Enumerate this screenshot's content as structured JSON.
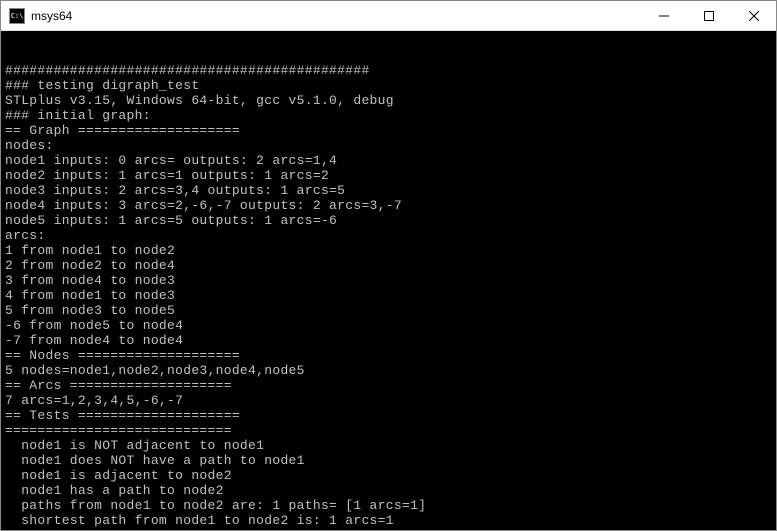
{
  "window": {
    "title": "msys64",
    "icon_text": "C:\\"
  },
  "terminal": {
    "lines": [
      "#############################################",
      "### testing digraph_test",
      "STLplus v3.15, Windows 64-bit, gcc v5.1.0, debug",
      "### initial graph:",
      "== Graph ====================",
      "nodes:",
      "node1 inputs: 0 arcs= outputs: 2 arcs=1,4",
      "node2 inputs: 1 arcs=1 outputs: 1 arcs=2",
      "node3 inputs: 2 arcs=3,4 outputs: 1 arcs=5",
      "node4 inputs: 3 arcs=2,-6,-7 outputs: 2 arcs=3,-7",
      "node5 inputs: 1 arcs=5 outputs: 1 arcs=-6",
      "arcs:",
      "1 from node1 to node2",
      "2 from node2 to node4",
      "3 from node4 to node3",
      "4 from node1 to node3",
      "5 from node3 to node5",
      "-6 from node5 to node4",
      "-7 from node4 to node4",
      "== Nodes ====================",
      "5 nodes=node1,node2,node3,node4,node5",
      "== Arcs ====================",
      "7 arcs=1,2,3,4,5,-6,-7",
      "== Tests ====================",
      "============================",
      "  node1 is NOT adjacent to node1",
      "  node1 does NOT have a path to node1",
      "  node1 is adjacent to node2",
      "  node1 has a path to node2",
      "  paths from node1 to node2 are: 1 paths= [1 arcs=1]",
      "  shortest path from node1 to node2 is: 1 arcs=1"
    ]
  }
}
